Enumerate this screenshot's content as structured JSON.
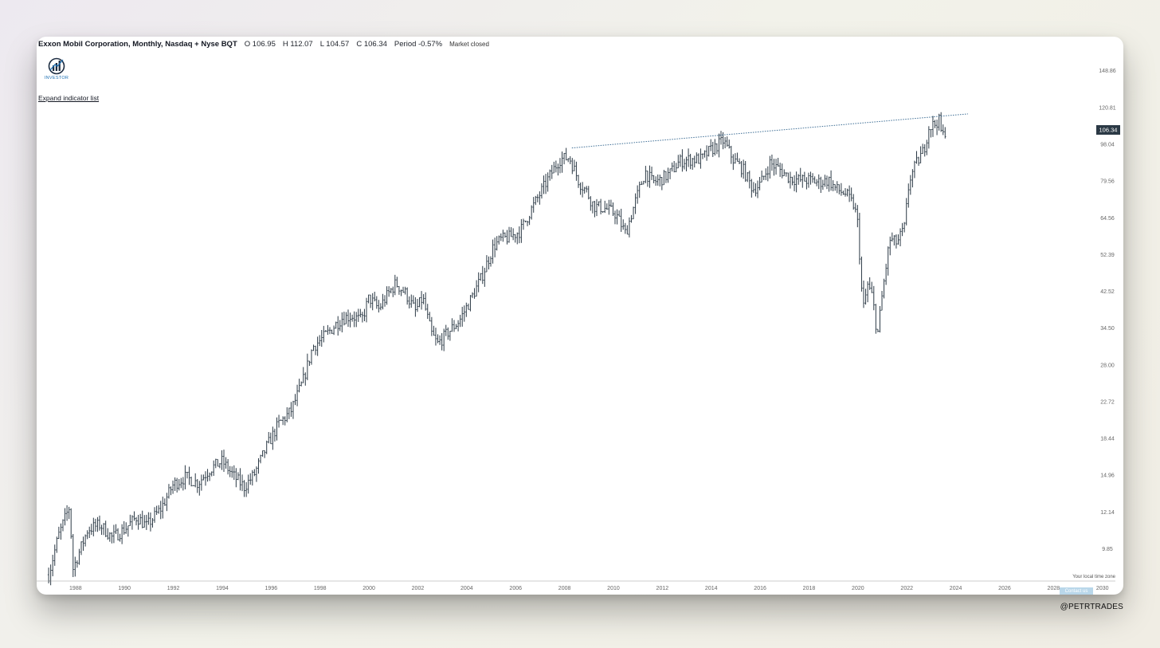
{
  "header": {
    "title": "Exxon Mobil Corporation, Monthly, Nasdaq + Nyse BQT",
    "open": "O 106.95",
    "high": "H 112.07",
    "low": "L 104.57",
    "close": "C 106.34",
    "period": "Period -0.57%",
    "status": "Market closed"
  },
  "logo": {
    "text": "INVESTOR"
  },
  "expand_label": "Expand indicator list",
  "timezone_label": "Your local time zone",
  "contact_label": "Contact us",
  "watermark": "@PETRTRADES",
  "colors": {
    "bars": "#2b3945",
    "trendline": "#3f6f96",
    "price_tag_bg": "#2b3945",
    "contact_bg": "#b9d7ea"
  },
  "chart_data": {
    "type": "ohlc",
    "title": "Exxon Mobil Corporation, Monthly, Nasdaq + Nyse BQT",
    "scale": "log",
    "ylim": [
      8.2,
      165
    ],
    "xlim": [
      1986.8,
      2030.4
    ],
    "grid": false,
    "y_ticks": [
      "148.86",
      "120.81",
      "98.04",
      "79.56",
      "64.56",
      "52.39",
      "42.52",
      "34.50",
      "28.00",
      "22.72",
      "18.44",
      "14.96",
      "12.14",
      "9.85"
    ],
    "x_ticks": [
      "1988",
      "1990",
      "1992",
      "1994",
      "1996",
      "1998",
      "2000",
      "2002",
      "2004",
      "2006",
      "2008",
      "2010",
      "2012",
      "2014",
      "2016",
      "2018",
      "2020",
      "2022",
      "2024",
      "2026",
      "2028",
      "2030"
    ],
    "last_price": "106.34",
    "last_price_value": 106.34,
    "trendline": {
      "points": [
        [
          2008.3,
          96.0
        ],
        [
          2024.5,
          116.5
        ]
      ],
      "style": "dotted"
    },
    "price_path": [
      [
        1986.9,
        8.5
      ],
      [
        1987.3,
        10.6
      ],
      [
        1987.75,
        12.5
      ],
      [
        1987.9,
        8.8
      ],
      [
        1988.5,
        11.0
      ],
      [
        1989.0,
        11.3
      ],
      [
        1989.5,
        10.5
      ],
      [
        1990.0,
        11.0
      ],
      [
        1990.5,
        11.8
      ],
      [
        1990.9,
        11.2
      ],
      [
        1991.5,
        12.4
      ],
      [
        1992.0,
        14.2
      ],
      [
        1992.5,
        14.8
      ],
      [
        1993.0,
        14.3
      ],
      [
        1993.5,
        15.5
      ],
      [
        1994.0,
        16.2
      ],
      [
        1994.5,
        14.8
      ],
      [
        1994.9,
        14.0
      ],
      [
        1995.3,
        15.0
      ],
      [
        1995.8,
        17.5
      ],
      [
        1996.3,
        20.0
      ],
      [
        1996.8,
        21.5
      ],
      [
        1997.3,
        25.5
      ],
      [
        1997.7,
        31.0
      ],
      [
        1998.2,
        33.0
      ],
      [
        1998.6,
        35.0
      ],
      [
        1998.9,
        36.5
      ],
      [
        1999.3,
        37.0
      ],
      [
        1999.7,
        36.0
      ],
      [
        2000.0,
        41.0
      ],
      [
        2000.4,
        38.5
      ],
      [
        2000.8,
        42.0
      ],
      [
        2001.1,
        44.5
      ],
      [
        2001.5,
        42.0
      ],
      [
        2001.9,
        38.0
      ],
      [
        2002.2,
        41.0
      ],
      [
        2002.55,
        33.5
      ],
      [
        2002.8,
        31.5
      ],
      [
        2003.2,
        33.5
      ],
      [
        2003.7,
        36.0
      ],
      [
        2004.2,
        41.0
      ],
      [
        2004.6,
        46.0
      ],
      [
        2005.1,
        55.0
      ],
      [
        2005.4,
        57.0
      ],
      [
        2005.8,
        58.0
      ],
      [
        2006.2,
        60.0
      ],
      [
        2006.6,
        67.0
      ],
      [
        2007.0,
        74.0
      ],
      [
        2007.4,
        82.0
      ],
      [
        2007.8,
        90.0
      ],
      [
        2008.2,
        91.0
      ],
      [
        2008.6,
        79.0
      ],
      [
        2008.9,
        75.0
      ],
      [
        2009.2,
        69.0
      ],
      [
        2009.7,
        68.0
      ],
      [
        2010.1,
        66.0
      ],
      [
        2010.5,
        59.0
      ],
      [
        2010.9,
        71.0
      ],
      [
        2011.3,
        84.0
      ],
      [
        2011.6,
        79.0
      ],
      [
        2011.9,
        80.0
      ],
      [
        2012.3,
        83.0
      ],
      [
        2012.7,
        89.0
      ],
      [
        2013.2,
        90.0
      ],
      [
        2013.6,
        90.0
      ],
      [
        2013.9,
        94.0
      ],
      [
        2014.2,
        97.0
      ],
      [
        2014.5,
        100.0
      ],
      [
        2014.9,
        90.0
      ],
      [
        2015.3,
        85.0
      ],
      [
        2015.7,
        76.0
      ],
      [
        2016.0,
        78.0
      ],
      [
        2016.4,
        88.0
      ],
      [
        2016.8,
        85.0
      ],
      [
        2017.2,
        81.0
      ],
      [
        2017.6,
        80.0
      ],
      [
        2018.0,
        80.0
      ],
      [
        2018.4,
        79.0
      ],
      [
        2018.8,
        80.0
      ],
      [
        2019.1,
        76.0
      ],
      [
        2019.5,
        74.0
      ],
      [
        2019.85,
        69.0
      ],
      [
        2020.0,
        62.0
      ],
      [
        2020.2,
        38.0
      ],
      [
        2020.4,
        44.0
      ],
      [
        2020.6,
        41.0
      ],
      [
        2020.8,
        33.0
      ],
      [
        2021.0,
        42.0
      ],
      [
        2021.3,
        57.0
      ],
      [
        2021.6,
        56.0
      ],
      [
        2021.9,
        61.0
      ],
      [
        2022.1,
        80.0
      ],
      [
        2022.4,
        88.0
      ],
      [
        2022.7,
        95.0
      ],
      [
        2022.9,
        108.0
      ],
      [
        2023.15,
        110.0
      ],
      [
        2023.3,
        113.0
      ],
      [
        2023.45,
        102.0
      ],
      [
        2023.6,
        107.0
      ]
    ]
  }
}
